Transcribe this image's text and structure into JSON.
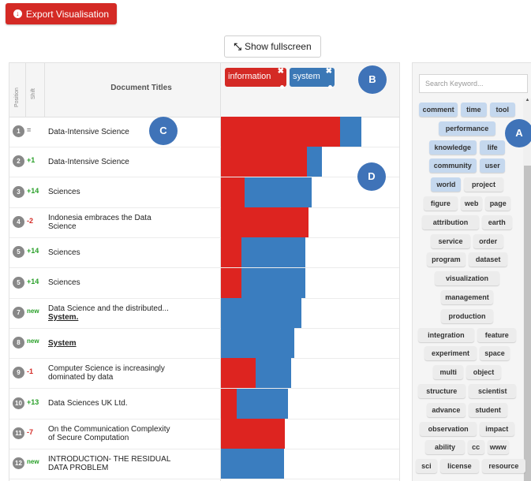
{
  "toolbar": {
    "export_label": "Export Visualisation",
    "fullscreen_label": "Show fullscreen"
  },
  "table": {
    "position_header": "Position",
    "shift_header": "Shift",
    "titles_header": "Document Titles"
  },
  "chips": [
    {
      "label": "information",
      "color": "#d42a25"
    },
    {
      "label": "system",
      "color": "#3b78b6"
    }
  ],
  "colors": {
    "information": "#dd2420",
    "system": "#3a7dbf",
    "new": "#2aa02a",
    "up": "#2aa02a",
    "down": "#d42a25"
  },
  "rows": [
    {
      "pos": "1",
      "shift": "=",
      "title": [
        "Data-Intensive Science"
      ],
      "information": 0.85,
      "system": 0.15
    },
    {
      "pos": "2",
      "shift": "+1",
      "title": [
        "Data-Intensive Science"
      ],
      "information": 0.85,
      "system": 0.15
    },
    {
      "pos": "3",
      "shift": "+14",
      "title": [
        "Sciences"
      ],
      "information": 0.26,
      "system": 0.74
    },
    {
      "pos": "4",
      "shift": "-2",
      "title": [
        "Indonesia embraces the Data",
        "Science"
      ],
      "information": 1.0,
      "system": 0.0
    },
    {
      "pos": "5",
      "shift": "+14",
      "title": [
        "Sciences"
      ],
      "information": 0.24,
      "system": 0.76
    },
    {
      "pos": "5",
      "shift": "+14",
      "title": [
        "Sciences"
      ],
      "information": 0.24,
      "system": 0.76
    },
    {
      "pos": "7",
      "shift": "new",
      "title": [
        "Data Science and the distributed...",
        "System."
      ],
      "information": 0.0,
      "system": 1.0
    },
    {
      "pos": "8",
      "shift": "new",
      "title": [
        "System"
      ],
      "information": 0.0,
      "system": 1.0
    },
    {
      "pos": "9",
      "shift": "-1",
      "title": [
        "Computer Science is increasingly",
        "dominated by data"
      ],
      "information": 0.5,
      "system": 0.5
    },
    {
      "pos": "10",
      "shift": "+13",
      "title": [
        "Data Sciences UK Ltd."
      ],
      "information": 0.24,
      "system": 0.76
    },
    {
      "pos": "11",
      "shift": "-7",
      "title": [
        "On the Communication Complexity",
        "of Secure Computation"
      ],
      "information": 1.0,
      "system": 0.0
    },
    {
      "pos": "12",
      "shift": "new",
      "title": [
        "INTRODUCTION- THE RESIDUAL",
        "DATA PROBLEM"
      ],
      "information": 0.0,
      "system": 1.0
    }
  ],
  "markers": [
    "A",
    "B",
    "C",
    "D"
  ],
  "keywords": {
    "placeholder": "Search Keyword...",
    "items": [
      {
        "label": "comment",
        "selected": true
      },
      {
        "label": "time",
        "selected": true
      },
      {
        "label": "tool",
        "selected": true
      },
      {
        "label": "performance",
        "selected": true
      },
      {
        "label": "knowledge",
        "selected": true
      },
      {
        "label": "life",
        "selected": true
      },
      {
        "label": "community",
        "selected": true
      },
      {
        "label": "user",
        "selected": true
      },
      {
        "label": "world",
        "selected": true
      },
      {
        "label": "project",
        "selected": false
      },
      {
        "label": "figure",
        "selected": false
      },
      {
        "label": "web",
        "selected": false
      },
      {
        "label": "page",
        "selected": false
      },
      {
        "label": "attribution",
        "selected": false
      },
      {
        "label": "earth",
        "selected": false
      },
      {
        "label": "service",
        "selected": false
      },
      {
        "label": "order",
        "selected": false
      },
      {
        "label": "program",
        "selected": false
      },
      {
        "label": "dataset",
        "selected": false
      },
      {
        "label": "visualization",
        "selected": false
      },
      {
        "label": "management",
        "selected": false
      },
      {
        "label": "production",
        "selected": false
      },
      {
        "label": "integration",
        "selected": false
      },
      {
        "label": "feature",
        "selected": false
      },
      {
        "label": "experiment",
        "selected": false
      },
      {
        "label": "space",
        "selected": false
      },
      {
        "label": "multi",
        "selected": false
      },
      {
        "label": "object",
        "selected": false
      },
      {
        "label": "structure",
        "selected": false
      },
      {
        "label": "scientist",
        "selected": false
      },
      {
        "label": "advance",
        "selected": false
      },
      {
        "label": "student",
        "selected": false
      },
      {
        "label": "observation",
        "selected": false
      },
      {
        "label": "impact",
        "selected": false
      },
      {
        "label": "ability",
        "selected": false
      },
      {
        "label": "cc",
        "selected": false
      },
      {
        "label": "www",
        "selected": false
      },
      {
        "label": "sci",
        "selected": false
      },
      {
        "label": "license",
        "selected": false
      },
      {
        "label": "resource",
        "selected": false
      }
    ]
  }
}
